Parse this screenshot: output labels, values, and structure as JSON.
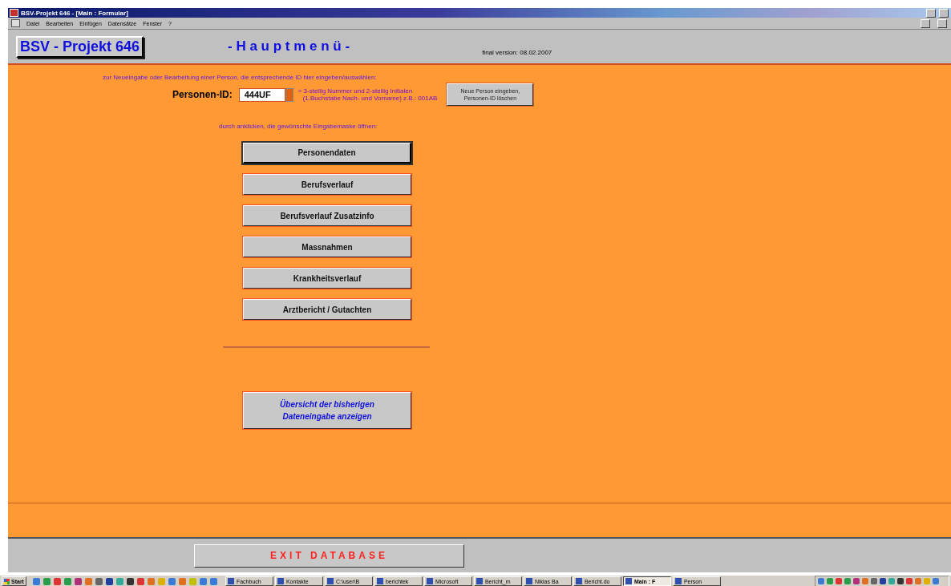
{
  "window": {
    "title": "BSV-Projekt 646 - [Main : Formular]"
  },
  "menu": [
    "Datei",
    "Bearbeiten",
    "Einfügen",
    "Datensätze",
    "Fenster",
    "?"
  ],
  "header": {
    "logo": "BSV - Projekt 646",
    "title": "- H a u p t m e n ü -",
    "version": "final version: 08.02.2007"
  },
  "instruction": "zur Neueingabe oder Bearbeitung einer Person, die entsprechende ID hier eingeben/auswählen:",
  "person_id": {
    "label": "Personen-ID:",
    "value": "444UF",
    "hint_1": "= 3-stellig Nummer und 2-stellig Initialen",
    "hint_2": "(1.Buchstabe Nach- und Vorname)  z.B.: 001AB",
    "new_button_1": "Neue Person eingeben,",
    "new_button_2": "Personen-ID löschen"
  },
  "open_instruction": "durch anklicken, die gewünschte Eingabemaske öffnen:",
  "forms": [
    {
      "label": "Personendaten",
      "focused": true
    },
    {
      "label": "Berufsverlauf",
      "focused": false
    },
    {
      "label": "Berufsverlauf Zusatzinfo",
      "focused": false
    },
    {
      "label": "Massnahmen",
      "focused": false
    },
    {
      "label": "Krankheitsverlauf",
      "focused": false
    },
    {
      "label": "Arztbericht / Gutachten",
      "focused": false
    }
  ],
  "overview_button": [
    "Übersicht der bisherigen",
    "Dateneingabe anzeigen"
  ],
  "exit_button": "EXIT DATABASE",
  "taskbar": {
    "start": "Start",
    "items": [
      {
        "label": "Fachbuch",
        "selected": false
      },
      {
        "label": "Kontakte",
        "selected": false
      },
      {
        "label": "C:\\user\\B",
        "selected": false
      },
      {
        "label": "berichtek",
        "selected": false
      },
      {
        "label": "Microsoft",
        "selected": false
      },
      {
        "label": "Bericht_m",
        "selected": false
      },
      {
        "label": "Niklas Ba",
        "selected": false
      },
      {
        "label": "Bericht.do",
        "selected": false
      },
      {
        "label": "Main : F",
        "selected": true
      },
      {
        "label": "Person",
        "selected": false
      }
    ]
  }
}
